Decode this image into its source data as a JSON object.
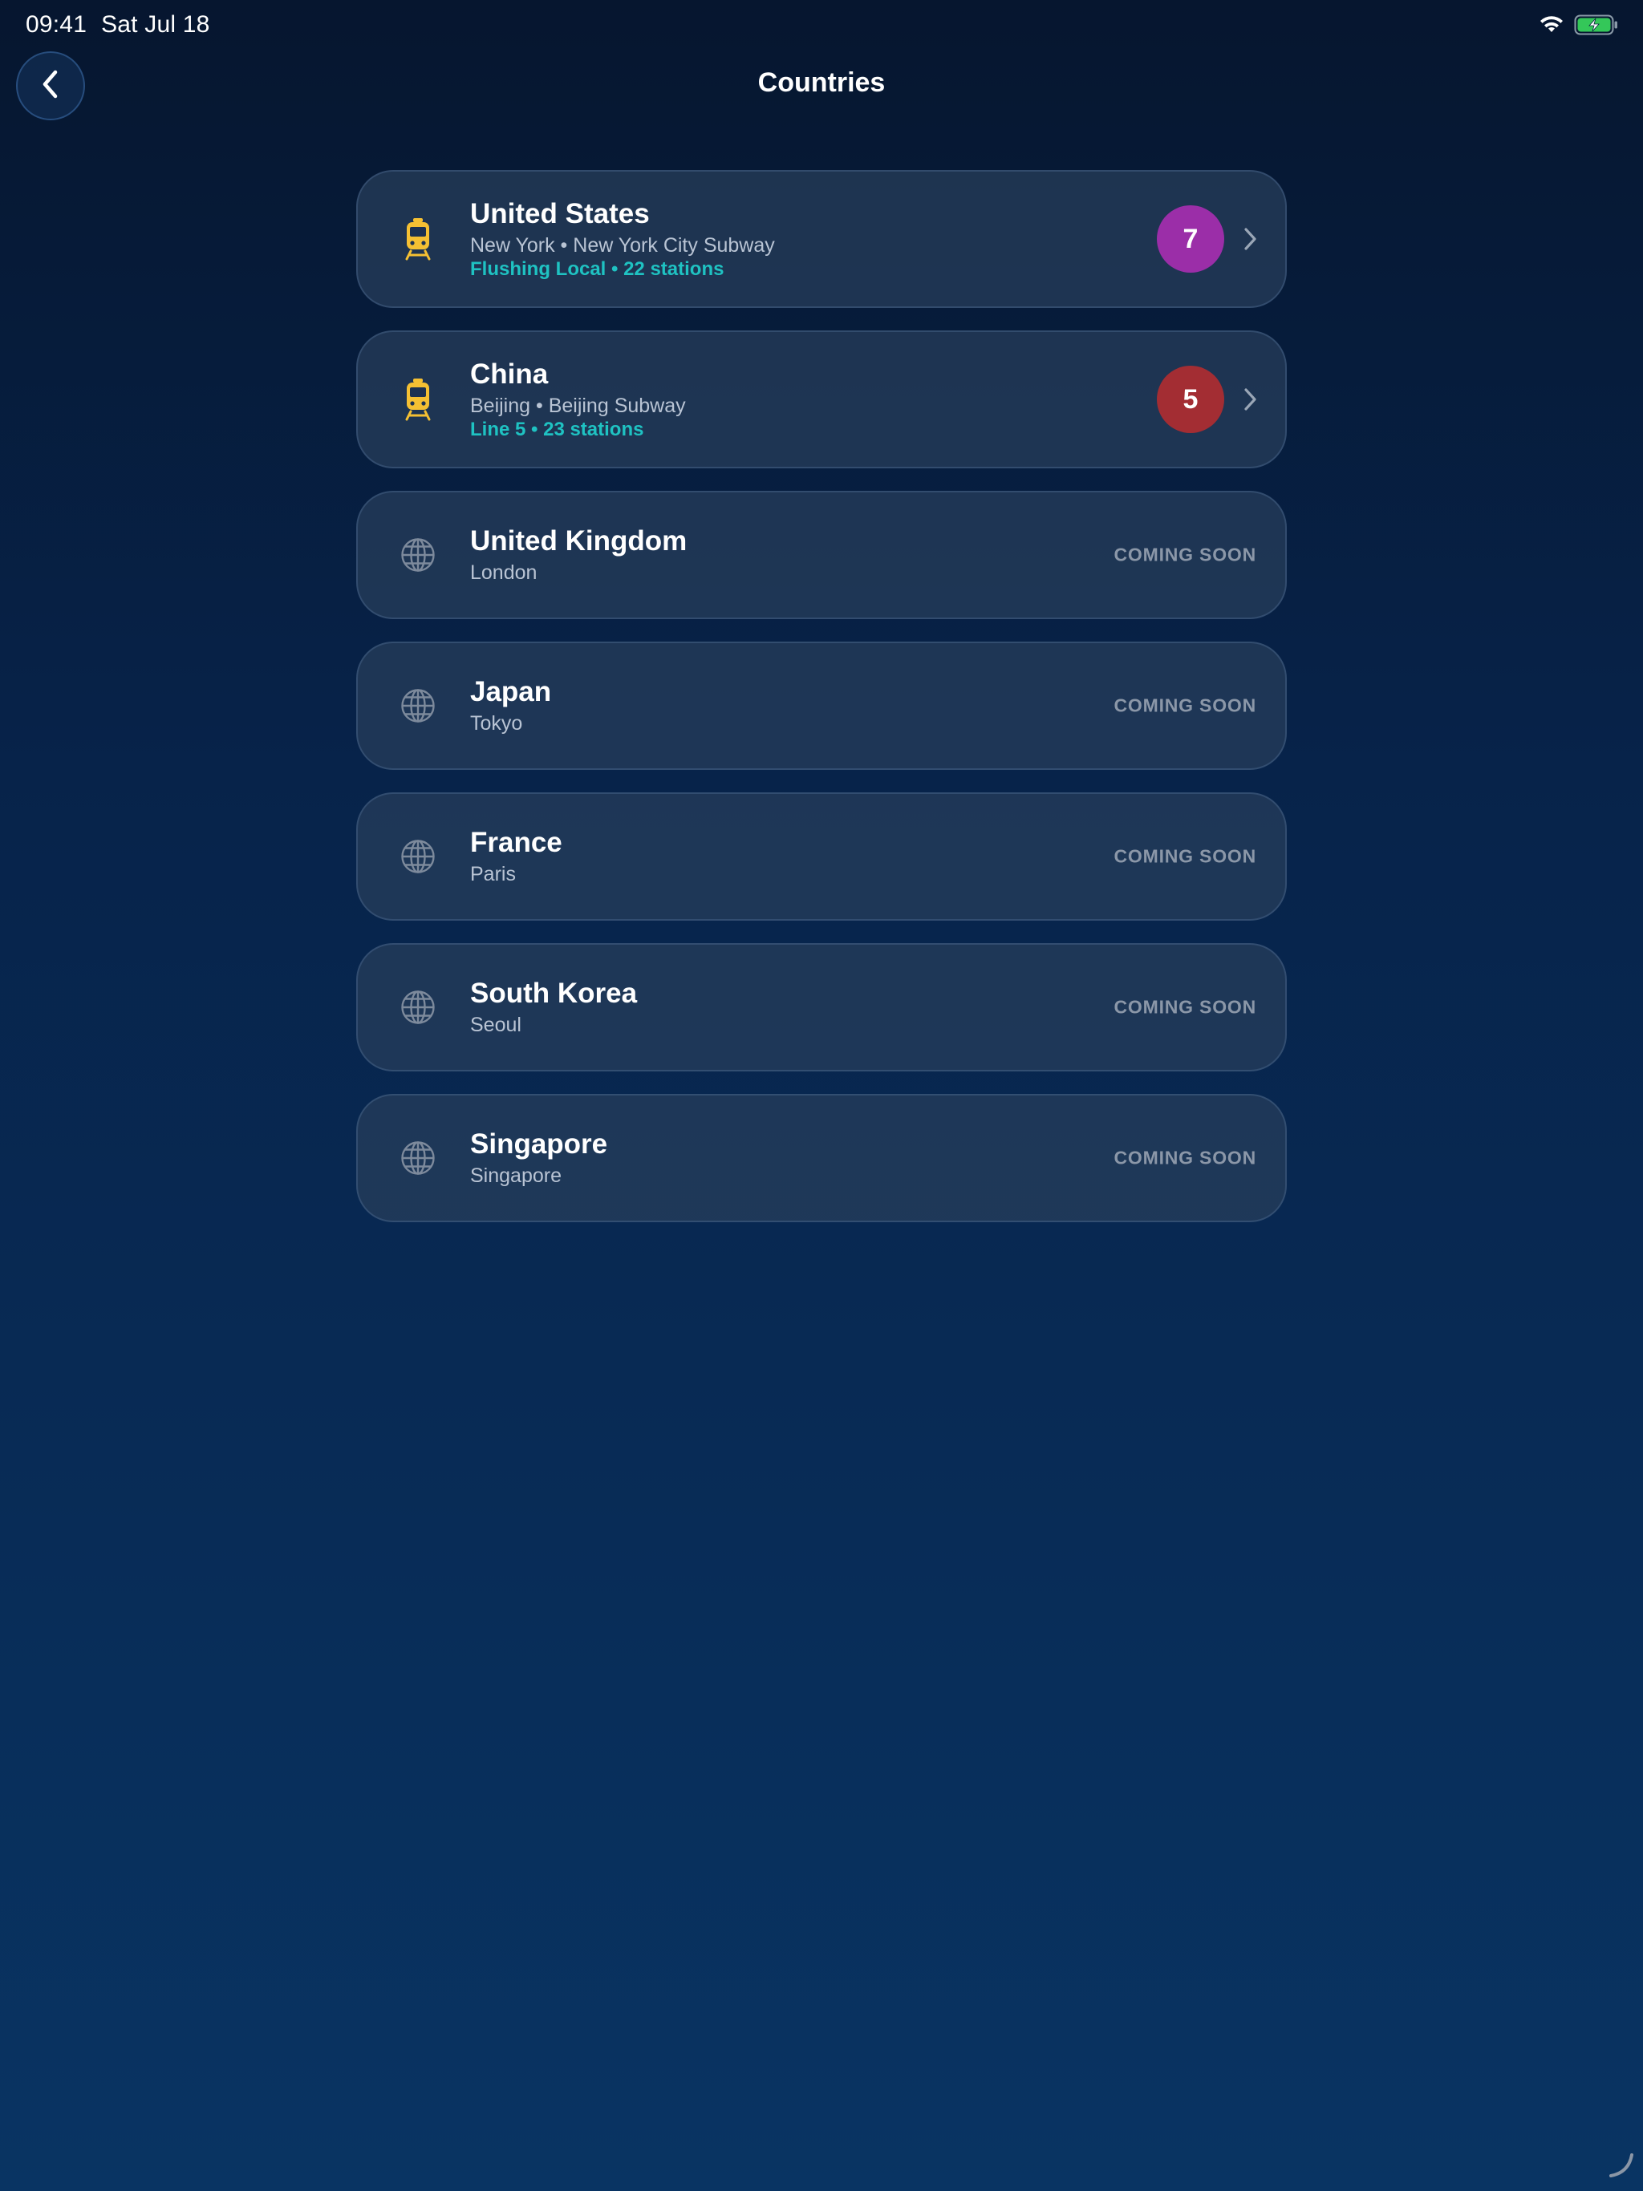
{
  "status_bar": {
    "time": "09:41",
    "date": "Sat Jul 18"
  },
  "header": {
    "title": "Countries"
  },
  "colors": {
    "accent_cyan": "#1fc2c2",
    "train_icon": "#f5c033",
    "coming_soon_text": "#8b97a8"
  },
  "countries": [
    {
      "name": "United States",
      "subtitle": "New York • New York City Subway",
      "line_info": "Flushing Local • 22 stations",
      "badge": "7",
      "badge_color": "#9b2ea8",
      "icon": "train-icon"
    },
    {
      "name": "China",
      "subtitle": "Beijing • Beijing Subway",
      "line_info": "Line 5 • 23 stations",
      "badge": "5",
      "badge_color": "#a32d33",
      "icon": "train-icon"
    },
    {
      "name": "United Kingdom",
      "subtitle": "London",
      "status": "COMING SOON",
      "icon": "globe-icon"
    },
    {
      "name": "Japan",
      "subtitle": "Tokyo",
      "status": "COMING SOON",
      "icon": "globe-icon"
    },
    {
      "name": "France",
      "subtitle": "Paris",
      "status": "COMING SOON",
      "icon": "globe-icon"
    },
    {
      "name": "South Korea",
      "subtitle": "Seoul",
      "status": "COMING SOON",
      "icon": "globe-icon"
    },
    {
      "name": "Singapore",
      "subtitle": "Singapore",
      "status": "COMING SOON",
      "icon": "globe-icon"
    }
  ]
}
